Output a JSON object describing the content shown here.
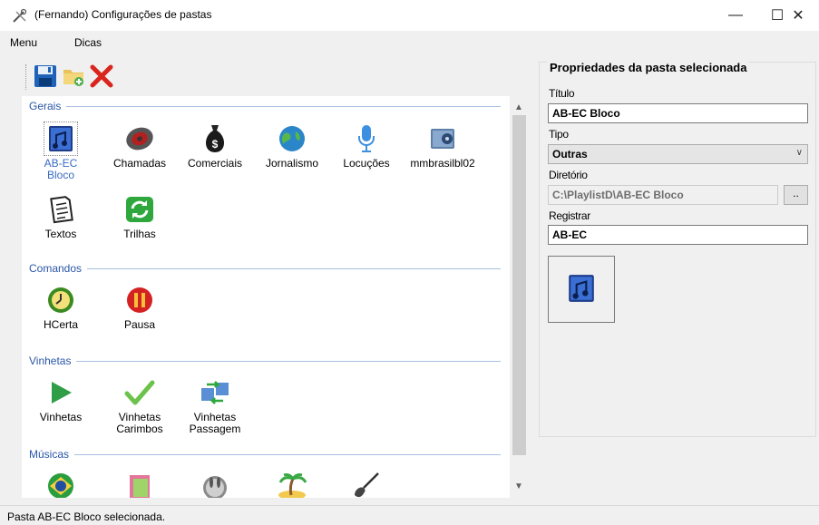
{
  "window": {
    "title": "(Fernando) Configurações de pastas",
    "minimize": "—",
    "maximize": "☐",
    "close": "✕"
  },
  "menu": {
    "items": [
      {
        "label": "Menu"
      },
      {
        "label": "Dicas"
      }
    ]
  },
  "toolbar": {
    "buttons": [
      {
        "icon": "save-icon"
      },
      {
        "icon": "new-folder-icon"
      },
      {
        "icon": "delete-icon"
      }
    ]
  },
  "groups": [
    {
      "label": "Gerais",
      "items": [
        {
          "label": "AB-EC\nBloco",
          "icon": "music-document-icon",
          "selected": true
        },
        {
          "label": "Chamadas",
          "icon": "record-disc-icon"
        },
        {
          "label": "Comerciais",
          "icon": "money-bag-icon"
        },
        {
          "label": "Jornalismo",
          "icon": "globe-icon"
        },
        {
          "label": "Locuções",
          "icon": "microphone-icon"
        },
        {
          "label": "mmbrasilbl02",
          "icon": "media-folder-icon"
        },
        {
          "label": "Textos",
          "icon": "text-document-icon"
        },
        {
          "label": "Trilhas",
          "icon": "refresh-arrows-icon"
        }
      ]
    },
    {
      "label": "Comandos",
      "items": [
        {
          "label": "HCerta",
          "icon": "clock-icon"
        },
        {
          "label": "Pausa",
          "icon": "pause-icon"
        }
      ]
    },
    {
      "label": "Vinhetas",
      "items": [
        {
          "label": "Vinhetas",
          "icon": "play-triangle-icon"
        },
        {
          "label": "Vinhetas\nCarimbos",
          "icon": "checkmark-icon"
        },
        {
          "label": "Vinhetas\nPassagem",
          "icon": "transfer-arrows-icon"
        }
      ]
    },
    {
      "label": "Músicas",
      "items": [
        {
          "label": "",
          "icon": "brazil-flag-icon"
        },
        {
          "label": "",
          "icon": "music-book-icon"
        },
        {
          "label": "",
          "icon": "bunny-icon"
        },
        {
          "label": "",
          "icon": "island-icon"
        },
        {
          "label": "",
          "icon": "guitar-icon"
        }
      ]
    }
  ],
  "properties": {
    "title": "Propriedades da pasta selecionada",
    "titulo_label": "Título",
    "titulo_value": "AB-EC Bloco",
    "tipo_label": "Tipo",
    "tipo_value": "Outras",
    "diretorio_label": "Diretório",
    "diretorio_value": "C:\\PlaylistD\\AB-EC Bloco",
    "browse_label": "..",
    "registrar_label": "Registrar",
    "registrar_value": "AB-EC",
    "preview_icon": "music-document-icon"
  },
  "status": {
    "text": "Pasta AB-EC Bloco selecionada."
  },
  "scrollbar": {
    "up": "▲",
    "down": "▼"
  }
}
